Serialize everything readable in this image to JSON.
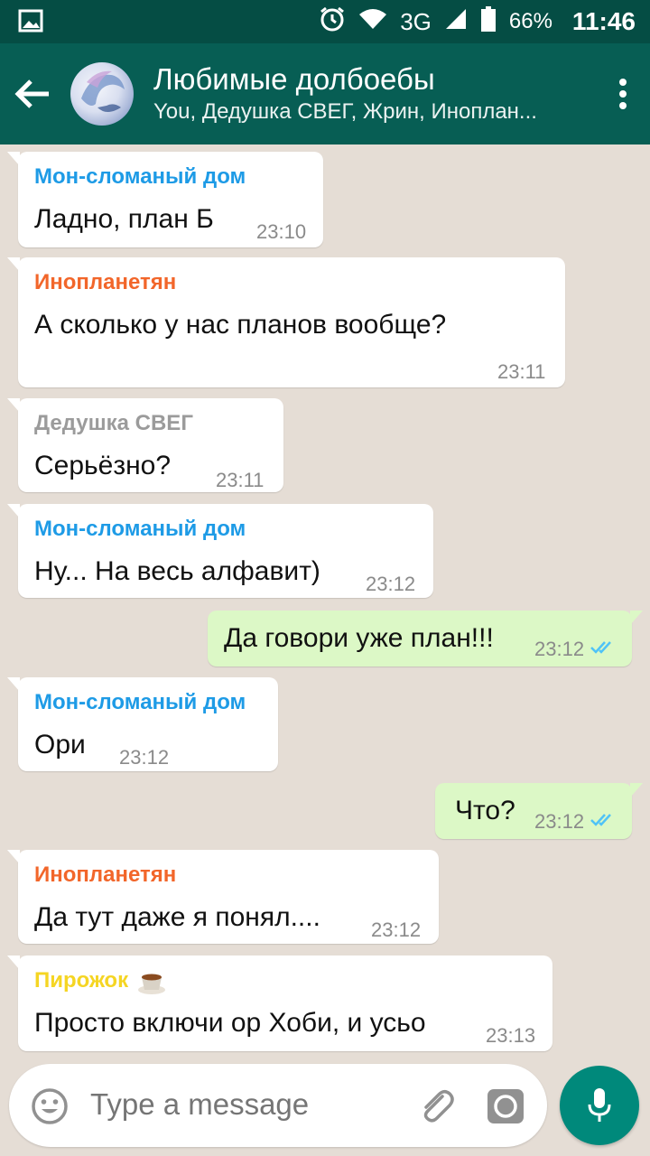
{
  "status_bar": {
    "network": "3G",
    "battery": "66%",
    "time": "11:46"
  },
  "header": {
    "title": "Любимые долбоебы",
    "subtitle": "You, Дедушка СВЕГ, Жрин, Иноплан..."
  },
  "messages": [
    {
      "direction": "in",
      "sender": "Мон-сломаный дом",
      "sender_color": "#1e9be6",
      "text": "Ладно, план Б",
      "time": "23:10"
    },
    {
      "direction": "in",
      "sender": "Инопланетян",
      "sender_color": "#f2662a",
      "text": "А сколько у нас планов вообще?",
      "time": "23:11"
    },
    {
      "direction": "in",
      "sender": "Дедушка СВЕГ",
      "sender_color": "#9b9b9b",
      "text": "Серьёзно?",
      "time": "23:11"
    },
    {
      "direction": "in",
      "sender": "Мон-сломаный дом",
      "sender_color": "#1e9be6",
      "text": "Ну... На весь алфавит)",
      "time": "23:12"
    },
    {
      "direction": "out",
      "text": "Да говори уже план!!!",
      "time": "23:12",
      "status": "read"
    },
    {
      "direction": "in",
      "sender": "Мон-сломаный дом",
      "sender_color": "#1e9be6",
      "text": "Ори",
      "time": "23:12"
    },
    {
      "direction": "out",
      "text": "Что?",
      "time": "23:12",
      "status": "read"
    },
    {
      "direction": "in",
      "sender": "Инопланетян",
      "sender_color": "#f2662a",
      "text": "Да тут даже я понял....",
      "time": "23:12"
    },
    {
      "direction": "in",
      "sender": "Пирожок",
      "sender_color": "#f5d523",
      "sender_emoji": "coffee-emoji",
      "text": "Просто включи ор Хоби, и усьо",
      "time": "23:13"
    }
  ],
  "input": {
    "placeholder": "Type a message"
  },
  "icons": {
    "back": "arrow-back-icon",
    "menu": "more-vert-icon",
    "emoji": "emoji-icon",
    "attach": "paperclip-icon",
    "camera": "camera-icon",
    "mic": "mic-icon"
  },
  "colors": {
    "header": "#075e54",
    "status_bar": "#054d44",
    "outgoing_bubble": "#dcf8c6",
    "read_ticks": "#4fc3f7",
    "mic_button": "#00897b"
  }
}
